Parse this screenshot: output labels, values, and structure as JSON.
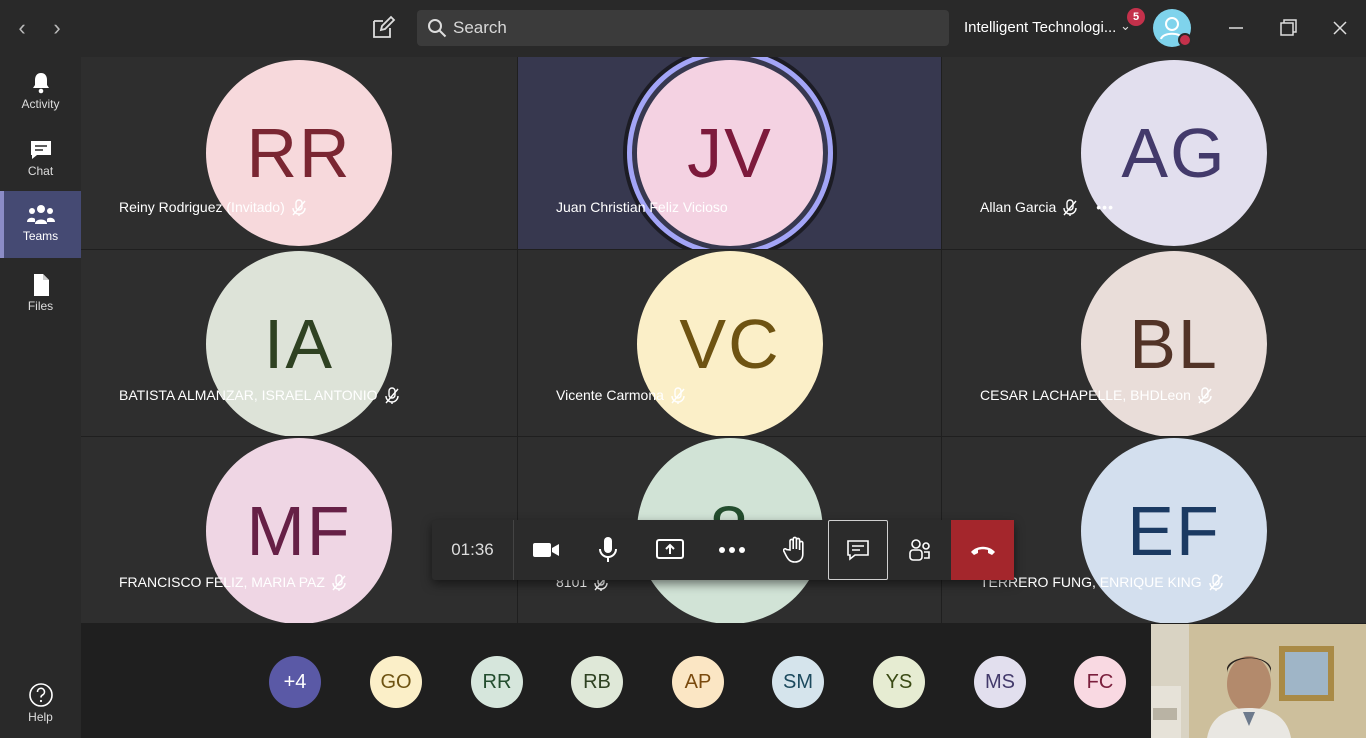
{
  "titlebar": {
    "search_placeholder": "Search",
    "org_name": "Intelligent Technologi...",
    "notification_count": "5"
  },
  "rail": [
    {
      "label": "Activity",
      "icon": "bell-icon"
    },
    {
      "label": "Chat",
      "icon": "chat-icon"
    },
    {
      "label": "Teams",
      "icon": "teams-icon",
      "active": true
    },
    {
      "label": "Files",
      "icon": "file-icon"
    },
    {
      "label": "Help",
      "icon": "help-icon"
    }
  ],
  "participants": [
    {
      "initials": "RR",
      "name": "Reiny Rodriguez (Invitado)",
      "muted": true,
      "bg": "#f7d9dc",
      "fg": "#7a2632"
    },
    {
      "initials": "JV",
      "name": "Juan Christian Feliz Vicioso",
      "muted": false,
      "speaking": true,
      "bg": "#f4d2e2",
      "fg": "#7d1a3c"
    },
    {
      "initials": "AG",
      "name": "Allan Garcia",
      "muted": true,
      "more": true,
      "bg": "#e2dfee",
      "fg": "#433a6b"
    },
    {
      "initials": "IA",
      "name": "BATISTA ALMANZAR, ISRAEL ANTONIO",
      "muted": true,
      "bg": "#dde3d8",
      "fg": "#2f4222"
    },
    {
      "initials": "VC",
      "name": "Vicente Carmona",
      "muted": true,
      "bg": "#fbefc8",
      "fg": "#6e5312"
    },
    {
      "initials": "BL",
      "name": "CESAR LACHAPELLE, BHDLeon",
      "muted": true,
      "bg": "#e9ddd9",
      "fg": "#523327"
    },
    {
      "initials": "MF",
      "name": "FRANCISCO FELIZ, MARIA PAZ",
      "muted": true,
      "bg": "#efd6e4",
      "fg": "#662046"
    },
    {
      "initials": "8",
      "name": "8101",
      "muted": true,
      "bg": "#d1e3d6",
      "fg": "#234d2e"
    },
    {
      "initials": "EF",
      "name": "TERRERO FUNG, ENRIQUE KING",
      "muted": true,
      "bg": "#d3dfee",
      "fg": "#1b3a62"
    }
  ],
  "callbar": {
    "timer": "01:36"
  },
  "roster": [
    {
      "initials": "+4",
      "bg": "#5a59a6",
      "fg": "#ffffff"
    },
    {
      "initials": "GO",
      "bg": "#fbefc8",
      "fg": "#6e5312"
    },
    {
      "initials": "RR",
      "bg": "#d6e6dc",
      "fg": "#234d2e"
    },
    {
      "initials": "RB",
      "bg": "#dfe8d8",
      "fg": "#2f4222"
    },
    {
      "initials": "AP",
      "bg": "#fbe6c4",
      "fg": "#7a4a0e"
    },
    {
      "initials": "SM",
      "bg": "#d5e4ec",
      "fg": "#1c4a5e"
    },
    {
      "initials": "YS",
      "bg": "#e6ecd2",
      "fg": "#3a4a14"
    },
    {
      "initials": "MS",
      "bg": "#e2dfee",
      "fg": "#433a6b"
    },
    {
      "initials": "FC",
      "bg": "#f9d9e2",
      "fg": "#7a1f3c"
    }
  ]
}
